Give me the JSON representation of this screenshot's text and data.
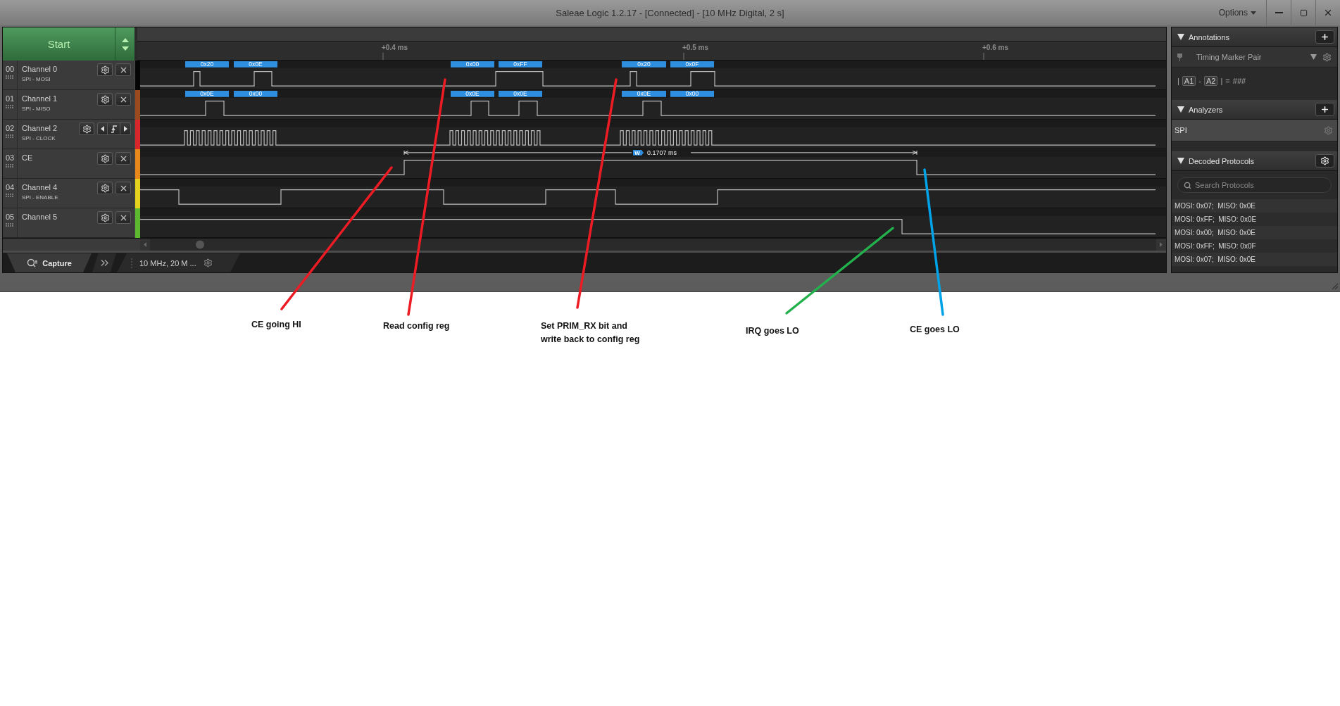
{
  "window": {
    "title": "Saleae Logic 1.2.17 - [Connected] - [10 MHz Digital, 2 s]",
    "menu": "Options"
  },
  "start_button": {
    "label": "Start"
  },
  "ruler": {
    "ticks": [
      "+0.4 ms",
      "+0.5 ms",
      "+0.6 ms"
    ]
  },
  "channels": [
    {
      "number": "00",
      "name": "Channel 0",
      "role": "SPI - MOSI",
      "color": "#050505",
      "kind": "normal",
      "decodes": [
        "0x20",
        "0x0E",
        "0x00",
        "0xFF",
        "0x20",
        "0x0F"
      ]
    },
    {
      "number": "01",
      "name": "Channel 1",
      "role": "SPI - MISO",
      "color": "#9a4a1c",
      "kind": "normal",
      "decodes": [
        "0x0E",
        "0x00",
        "0x0E",
        "0x0E",
        "0x0E",
        "0x00"
      ]
    },
    {
      "number": "02",
      "name": "Channel 2",
      "role": "SPI - CLOCK",
      "color": "#d8262b",
      "kind": "trigger"
    },
    {
      "number": "03",
      "name": "CE",
      "color": "#e8881a",
      "kind": "normal"
    },
    {
      "number": "04",
      "name": "Channel 4",
      "role": "SPI - ENABLE",
      "color": "#e6d21c",
      "kind": "normal"
    },
    {
      "number": "05",
      "name": "Channel 5",
      "color": "#5cb82e",
      "kind": "normal"
    }
  ],
  "measurement": {
    "badge": "W",
    "reading": "0.1707 ms"
  },
  "bottom_tabs": {
    "capture": "Capture",
    "settings": "10 MHz, 20 M ..."
  },
  "annotations": {
    "title": "Annotations",
    "marker": "Timing Marker Pair",
    "formula": [
      {
        "kind": "text",
        "text": "|"
      },
      {
        "kind": "chip",
        "text": "A1"
      },
      {
        "kind": "text",
        "text": "-"
      },
      {
        "kind": "chip",
        "text": "A2"
      },
      {
        "kind": "text",
        "text": "|"
      },
      {
        "kind": "text",
        "text": "="
      },
      {
        "kind": "text",
        "text": "###"
      }
    ]
  },
  "analyzers": {
    "title": "Analyzers",
    "items": [
      {
        "label": "SPI",
        "selected": true
      }
    ]
  },
  "decoded_protocols": {
    "title": "Decoded Protocols",
    "placeholder": "Search Protocols",
    "rows": [
      "MOSI: 0x07;  MISO: 0x0E",
      "MOSI: 0xFF;  MISO: 0x0E",
      "MOSI: 0x00;  MISO: 0x0E",
      "MOSI: 0xFF;  MISO: 0x0F",
      "MOSI: 0x07;  MISO: 0x0E"
    ]
  },
  "notes": [
    {
      "text": "CE going HI",
      "color": "#ed1c24"
    },
    {
      "text": "Read config reg",
      "color": "#ed1c24"
    },
    {
      "text": "Set PRIM_RX bit and write back to config reg",
      "color": "#ed1c24"
    },
    {
      "text": "IRQ goes LO",
      "color": "#22b14c"
    },
    {
      "text": "CE goes LO",
      "color": "#00a2e8"
    }
  ]
}
